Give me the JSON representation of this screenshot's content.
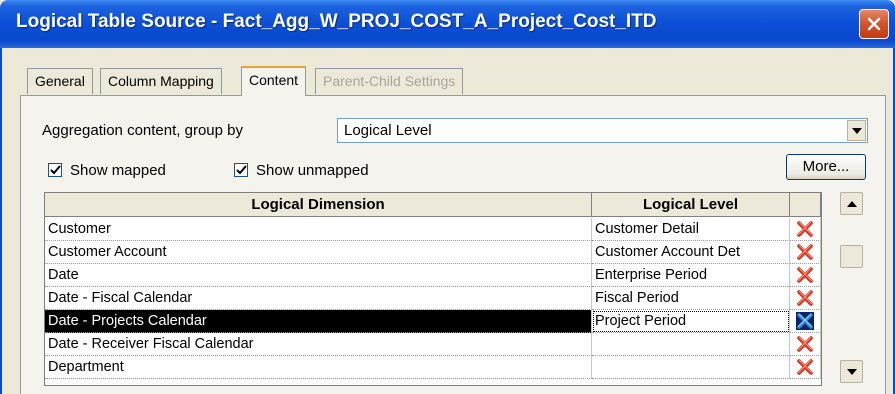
{
  "window": {
    "title": "Logical Table Source - Fact_Agg_W_PROJ_COST_A_Project_Cost_ITD"
  },
  "tabs": [
    {
      "label": "General",
      "state": "normal"
    },
    {
      "label": "Column Mapping",
      "state": "normal"
    },
    {
      "label": "Content",
      "state": "active"
    },
    {
      "label": "Parent-Child Settings",
      "state": "disabled"
    }
  ],
  "content": {
    "aggregation_label": "Aggregation content, group by",
    "aggregation_value": "Logical Level",
    "show_mapped_label": "Show mapped",
    "show_mapped_checked": true,
    "show_unmapped_label": "Show unmapped",
    "show_unmapped_checked": true,
    "more_label": "More..."
  },
  "grid": {
    "headers": [
      "Logical Dimension",
      "Logical Level"
    ],
    "rows": [
      {
        "dimension": "Customer",
        "level": "Customer Detail",
        "icon": "delete-red-x-icon"
      },
      {
        "dimension": "Customer Account",
        "level": "Customer Account Det",
        "icon": "delete-red-x-icon"
      },
      {
        "dimension": "Date",
        "level": "Enterprise Period",
        "icon": "delete-red-x-icon"
      },
      {
        "dimension": "Date - Fiscal Calendar",
        "level": "Fiscal Period",
        "icon": "delete-red-x-icon"
      },
      {
        "dimension": "Date - Projects Calendar",
        "level": "Project Period",
        "icon": "delete-blue-x-icon",
        "selected": true
      },
      {
        "dimension": "Date - Receiver Fiscal Calendar",
        "level": "",
        "icon": "delete-red-x-icon"
      },
      {
        "dimension": "Department",
        "level": "",
        "icon": "delete-red-x-icon"
      }
    ]
  },
  "colors": {
    "titlebar": "#0a48cc",
    "selection": "#000000",
    "delete_red": "#e0301e",
    "delete_blue": "#2f86d8"
  }
}
